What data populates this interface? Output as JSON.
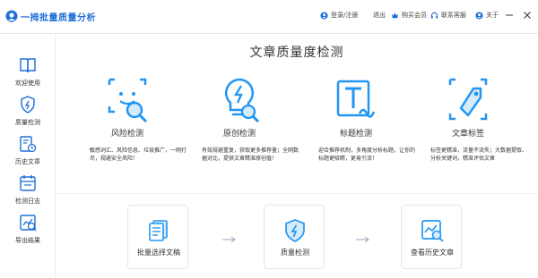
{
  "app": {
    "title": "一拇批量质量分析"
  },
  "titlebar": {
    "login": "登录/注册",
    "logout": "退出",
    "buy": "购买会员",
    "service": "联系客服",
    "about": "关于"
  },
  "sidebar": {
    "items": [
      {
        "label": "欢迎使用",
        "icon": "book-icon"
      },
      {
        "label": "质量检测",
        "icon": "shield-icon"
      },
      {
        "label": "历史文章",
        "icon": "history-doc-icon"
      },
      {
        "label": "检测日志",
        "icon": "calendar-icon"
      },
      {
        "label": "导出结果",
        "icon": "chart-export-icon"
      }
    ]
  },
  "main": {
    "title": "文章质量度检测",
    "features": [
      {
        "name": "风险检测",
        "desc": "敏感词汇、风险信息、垃圾推广，一网打尽，规避安全风险！"
      },
      {
        "name": "原创检测",
        "desc": "有效规避重复，获取更多推荐量；全网数据对比，提供文章精准原创值！"
      },
      {
        "name": "标题检测",
        "desc": "迎合推荐机制，多角度分析标题，让你的标题更吸睛，更易引流！"
      },
      {
        "name": "文章标签",
        "desc": "标签更精准，流量不流失；大数据提取、分析关键词，精准评估文章"
      }
    ],
    "actions": [
      {
        "label": "批量选择文稿"
      },
      {
        "label": "质量检测"
      },
      {
        "label": "查看历史文章"
      }
    ]
  },
  "colors": {
    "accent": "#1e88e5",
    "icon_blue": "#2196f3",
    "icon_light": "#d7ecfb"
  }
}
